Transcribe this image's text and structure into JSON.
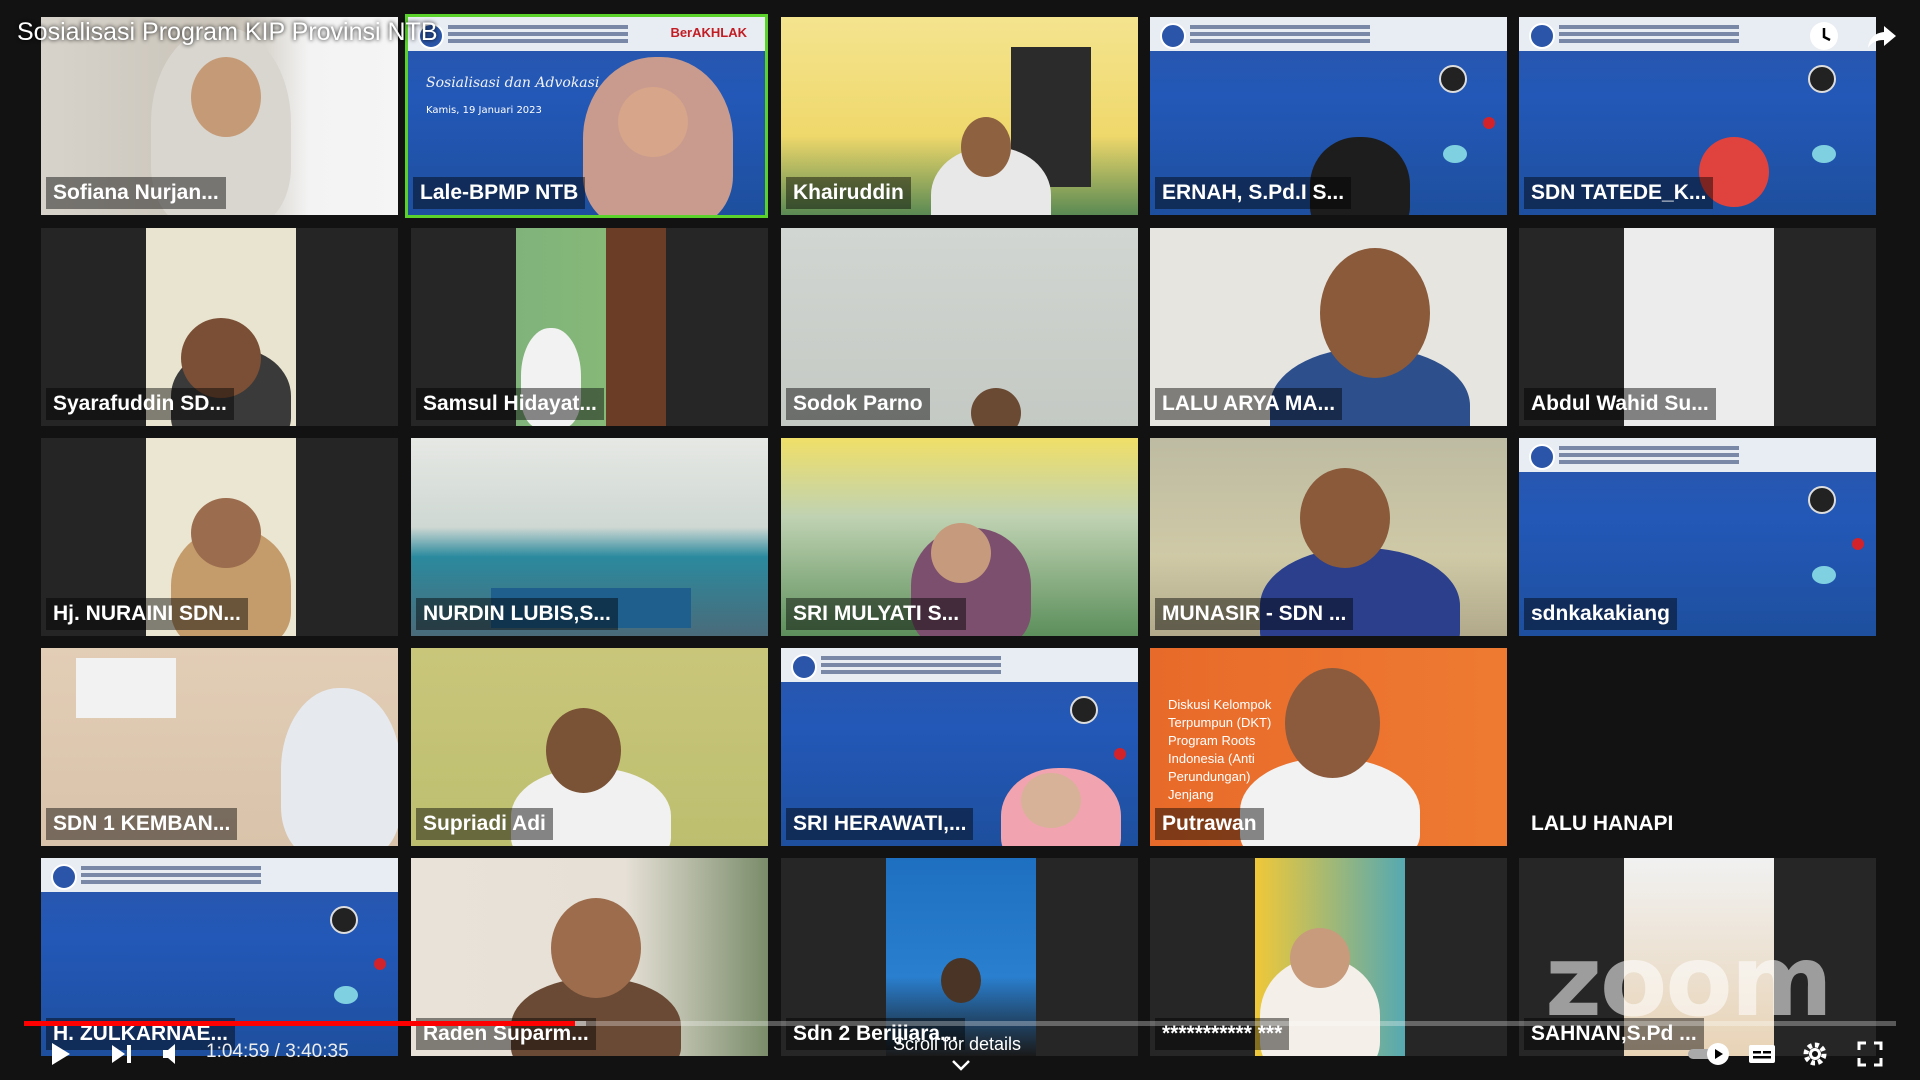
{
  "video": {
    "title": "Sosialisasi Program KIP Provinsi NTB",
    "time_current": "1:04:59",
    "time_separator": " / ",
    "time_total": "3:40:35",
    "progress_fraction": 0.2946,
    "buffer_fraction": 0.3,
    "scroll_hint": "Scroll for details",
    "watermark": "zoom",
    "colors": {
      "progress": "#ff0000",
      "active_speaker_border": "#5bd12b"
    }
  },
  "participants": [
    {
      "name": "Sofiana Nurjan...",
      "kind": "person"
    },
    {
      "name": "Lale-BPMP NTB",
      "kind": "slide",
      "active": true
    },
    {
      "name": "Khairuddin",
      "kind": "person"
    },
    {
      "name": "ERNAH, S.Pd.I S...",
      "kind": "slide"
    },
    {
      "name": "SDN TATEDE_K...",
      "kind": "slide"
    },
    {
      "name": "Syarafuddin SD...",
      "kind": "person"
    },
    {
      "name": "Samsul Hidayat...",
      "kind": "person"
    },
    {
      "name": "Sodok Parno",
      "kind": "person"
    },
    {
      "name": "LALU ARYA MA...",
      "kind": "person"
    },
    {
      "name": "Abdul Wahid Su...",
      "kind": "person"
    },
    {
      "name": "Hj. NURAINI SDN...",
      "kind": "person"
    },
    {
      "name": "NURDIN LUBIS,S...",
      "kind": "person"
    },
    {
      "name": "SRI MULYATI S...",
      "kind": "person"
    },
    {
      "name": "MUNASIR - SDN ...",
      "kind": "person"
    },
    {
      "name": "sdnkakakiang",
      "kind": "slide"
    },
    {
      "name": "SDN 1 KEMBAN...",
      "kind": "person"
    },
    {
      "name": "Supriadi Adi",
      "kind": "person"
    },
    {
      "name": "SRI HERAWATI,...",
      "kind": "slide"
    },
    {
      "name": "Putrawan",
      "kind": "person"
    },
    {
      "name": "LALU HANAPI",
      "kind": "no-video"
    },
    {
      "name": "H. ZULKARNAE...",
      "kind": "slide"
    },
    {
      "name": "Raden Suparm...",
      "kind": "person"
    },
    {
      "name": "Sdn 2 Berijiara...",
      "kind": "person"
    },
    {
      "name": "*********** ***",
      "kind": "person"
    },
    {
      "name": "SAHNAN,S.Pd ...",
      "kind": "person"
    }
  ],
  "slide_text": {
    "brand": "BerAKHLAK",
    "script": "Sosialisasi dan Advokasi",
    "date": "Kamis, 19 Januari 2023"
  },
  "poster_text": "Diskusi Kelompok Terpumpun (DKT) Program Roots Indonesia (Anti Perundungan) Jenjang"
}
